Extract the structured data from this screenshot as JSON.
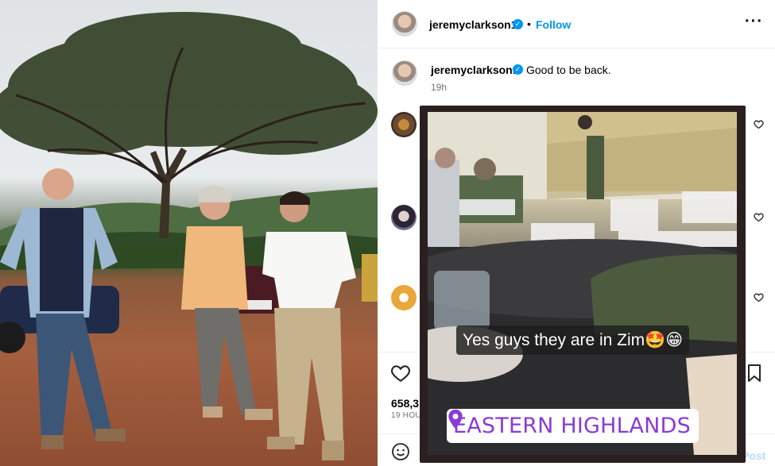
{
  "post": {
    "username": "jeremyclarkson1",
    "verified_mark": "✓",
    "separator": "•",
    "follow_label": "Follow",
    "more_icon": "more-options-icon",
    "caption": "Good to be back.",
    "caption_time": "19h",
    "likes": "658,3",
    "time_ago": "19 HOU",
    "post_label": "Post"
  },
  "overlay": {
    "caption_text": "Yes guys they are in Zim🤩😁",
    "location": "EASTERN HIGHLANDS",
    "location_icon": "location-pin-icon"
  },
  "colors": {
    "accent": "#0095f6",
    "location_text": "#8a3ad8",
    "overlay_frame": "#2a201f"
  }
}
